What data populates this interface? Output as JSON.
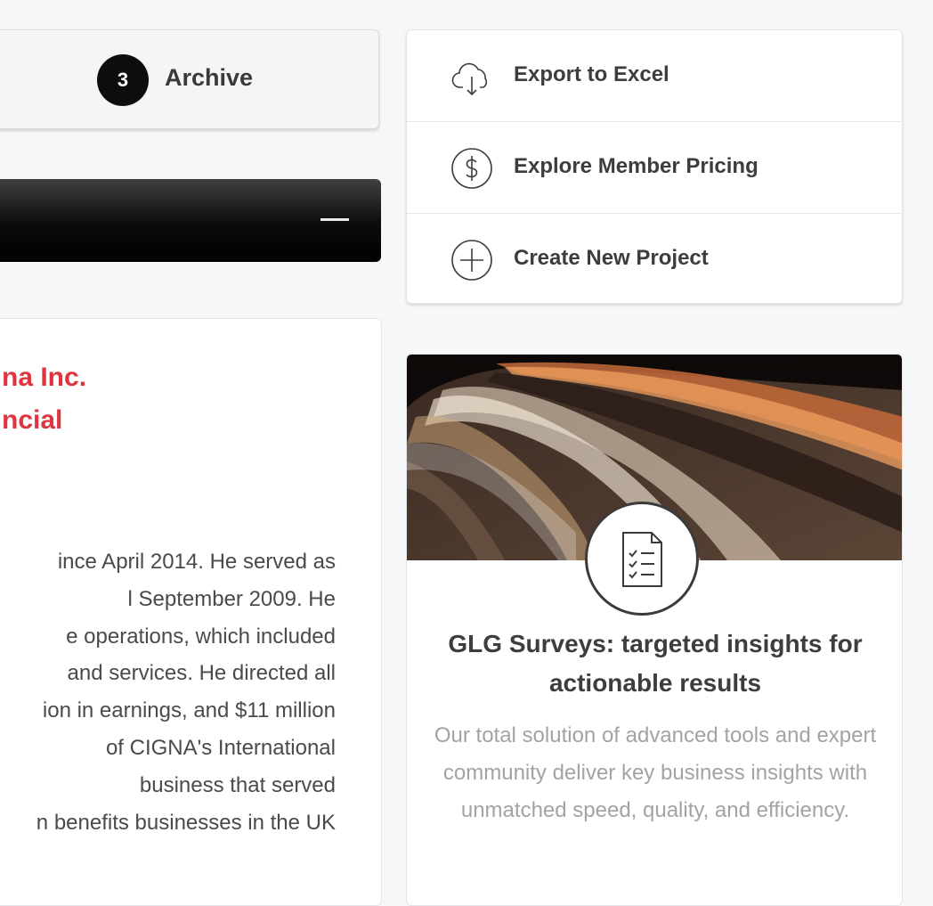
{
  "archive_step": {
    "number": "3",
    "label": "Archive"
  },
  "bio": {
    "name_lines": [
      "na Inc.",
      "ncial"
    ],
    "text_lines": [
      "ince April 2014. He served as",
      "l September 2009. He",
      "e operations, which included",
      " and services. He directed all",
      "ion in earnings, and $11 million",
      " of CIGNA's International",
      "business that served",
      "n benefits businesses in the UK"
    ]
  },
  "actions": [
    {
      "label": "Export to Excel",
      "icon": "cloud-download-icon"
    },
    {
      "label": "Explore Member Pricing",
      "icon": "dollar-circle-icon"
    },
    {
      "label": "Create New Project",
      "icon": "plus-circle-icon"
    }
  ],
  "survey": {
    "title": "GLG Surveys: targeted insights for actionable results",
    "description": "Our total solution of advanced tools and expert community deliver key business insights with unmatched speed, quality, and efficiency.",
    "image": "highway-light-trails-image",
    "badge_icon": "checklist-icon"
  }
}
